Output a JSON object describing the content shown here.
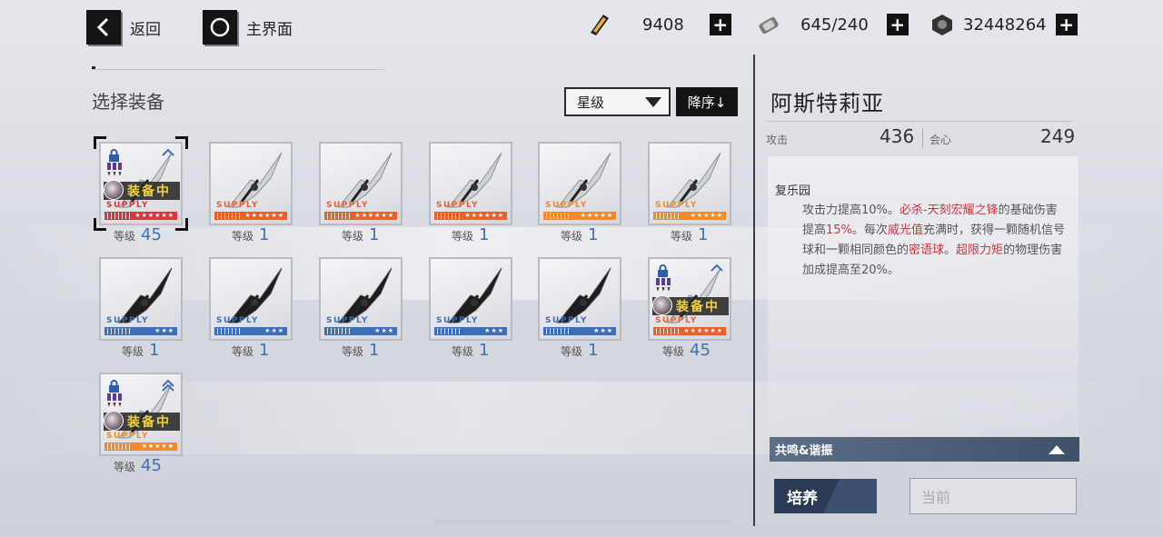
{
  "nav": {
    "back_label": "返回",
    "home_label": "主界面"
  },
  "resources": [
    {
      "icon": "gold-ticket-icon",
      "value": "9408"
    },
    {
      "icon": "battery-icon",
      "value": "645/240"
    },
    {
      "icon": "currency-coin-icon",
      "value": "32448264"
    }
  ],
  "equipment": {
    "title": "选择装备",
    "sort_value": "星级",
    "order_label": "降序↓",
    "level_label": "等级",
    "supply_text": "SUPPLY",
    "equipped_text": "装备中",
    "items": [
      {
        "level": "45",
        "stars": "★★★★★★",
        "color": "#d9363e",
        "equipped": true,
        "selected": true
      },
      {
        "level": "1",
        "stars": "★★★★★★",
        "color": "#e8612c",
        "equipped": false
      },
      {
        "level": "1",
        "stars": "★★★★★★",
        "color": "#e8612c",
        "equipped": false
      },
      {
        "level": "1",
        "stars": "★★★★★★",
        "color": "#e8612c",
        "equipped": false
      },
      {
        "level": "1",
        "stars": "★★★★★",
        "color": "#f08a2a",
        "equipped": false
      },
      {
        "level": "1",
        "stars": "★★★★★",
        "color": "#f08a2a",
        "equipped": false
      },
      {
        "level": "1",
        "stars": "★★★",
        "color": "#3f6db8",
        "equipped": false
      },
      {
        "level": "1",
        "stars": "★★★",
        "color": "#3f6db8",
        "equipped": false
      },
      {
        "level": "1",
        "stars": "★★★",
        "color": "#3f6db8",
        "equipped": false
      },
      {
        "level": "1",
        "stars": "★★★",
        "color": "#3f6db8",
        "equipped": false
      },
      {
        "level": "1",
        "stars": "★★★",
        "color": "#3f6db8",
        "equipped": false
      },
      {
        "level": "45",
        "stars": "★★★★★★",
        "color": "#e8612c",
        "equipped": true
      },
      {
        "level": "45",
        "stars": "★★★★★",
        "color": "#f08a2a",
        "equipped": true
      }
    ]
  },
  "detail": {
    "name": "阿斯特莉亚",
    "atk_label": "攻击",
    "atk_value": "436",
    "crit_label": "会心",
    "crit_value": "249",
    "skill_title": "复乐园",
    "skill_parts": [
      {
        "t": "攻击力提高10%。",
        "hl": false
      },
      {
        "t": "必杀-天刻宏耀之锋",
        "hl": true
      },
      {
        "t": "的基础伤害提高",
        "hl": false
      },
      {
        "t": "15%",
        "hl": true
      },
      {
        "t": "。每次",
        "hl": false
      },
      {
        "t": "威光值",
        "hl": true
      },
      {
        "t": "充满时，获得一颗随机信号球和一颗相同颜色的",
        "hl": false
      },
      {
        "t": "密语球",
        "hl": true
      },
      {
        "t": "。",
        "hl": false
      },
      {
        "t": "超限力矩",
        "hl": true
      },
      {
        "t": "的物理伤害加成提高至20%。",
        "hl": false
      }
    ],
    "resonance_label": "共鸣&谐振",
    "train_label": "培养",
    "current_label": "当前"
  }
}
